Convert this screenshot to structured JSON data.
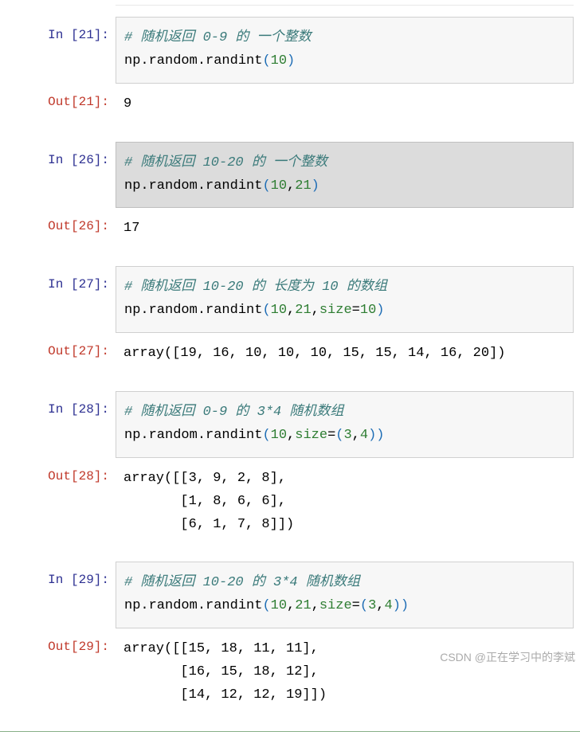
{
  "cells": [
    {
      "in_num": "21",
      "comment": "# 随机返回 0-9 的 一个整数",
      "code_plain": "np.random.randint",
      "code_args": "(10)",
      "highlighted": false,
      "out_num": "21",
      "output": "9"
    },
    {
      "in_num": "26",
      "comment": "# 随机返回 10-20 的 一个整数",
      "code_plain": "np.random.randint",
      "code_args": "(10,21)",
      "highlighted": true,
      "out_num": "26",
      "output": "17"
    },
    {
      "in_num": "27",
      "comment": "# 随机返回 10-20 的 长度为 10 的数组",
      "code_plain": "np.random.randint",
      "code_args_pre": "(10,21,",
      "code_kw": "size",
      "code_args_post": "=10)",
      "out_num": "27",
      "output": "array([19, 16, 10, 10, 10, 15, 15, 14, 16, 20])"
    },
    {
      "in_num": "28",
      "comment": "# 随机返回 0-9 的 3*4 随机数组",
      "code_plain": "np.random.randint",
      "code_args_pre": "(10,",
      "code_kw": "size",
      "code_args_post": "=(3,4))",
      "out_num": "28",
      "output": "array([[3, 9, 2, 8],\n       [1, 8, 6, 6],\n       [6, 1, 7, 8]])"
    },
    {
      "in_num": "29",
      "comment": "# 随机返回 10-20 的 3*4 随机数组",
      "code_plain": "np.random.randint",
      "code_args_pre": "(10,21,",
      "code_kw": "size",
      "code_args_post": "=(3,4))",
      "out_num": "29",
      "output": "array([[15, 18, 11, 11],\n       [16, 15, 18, 12],\n       [14, 12, 12, 19]])"
    }
  ],
  "labels": {
    "in": "In ",
    "out": "Out"
  },
  "watermark": "CSDN @正在学习中的李斌"
}
